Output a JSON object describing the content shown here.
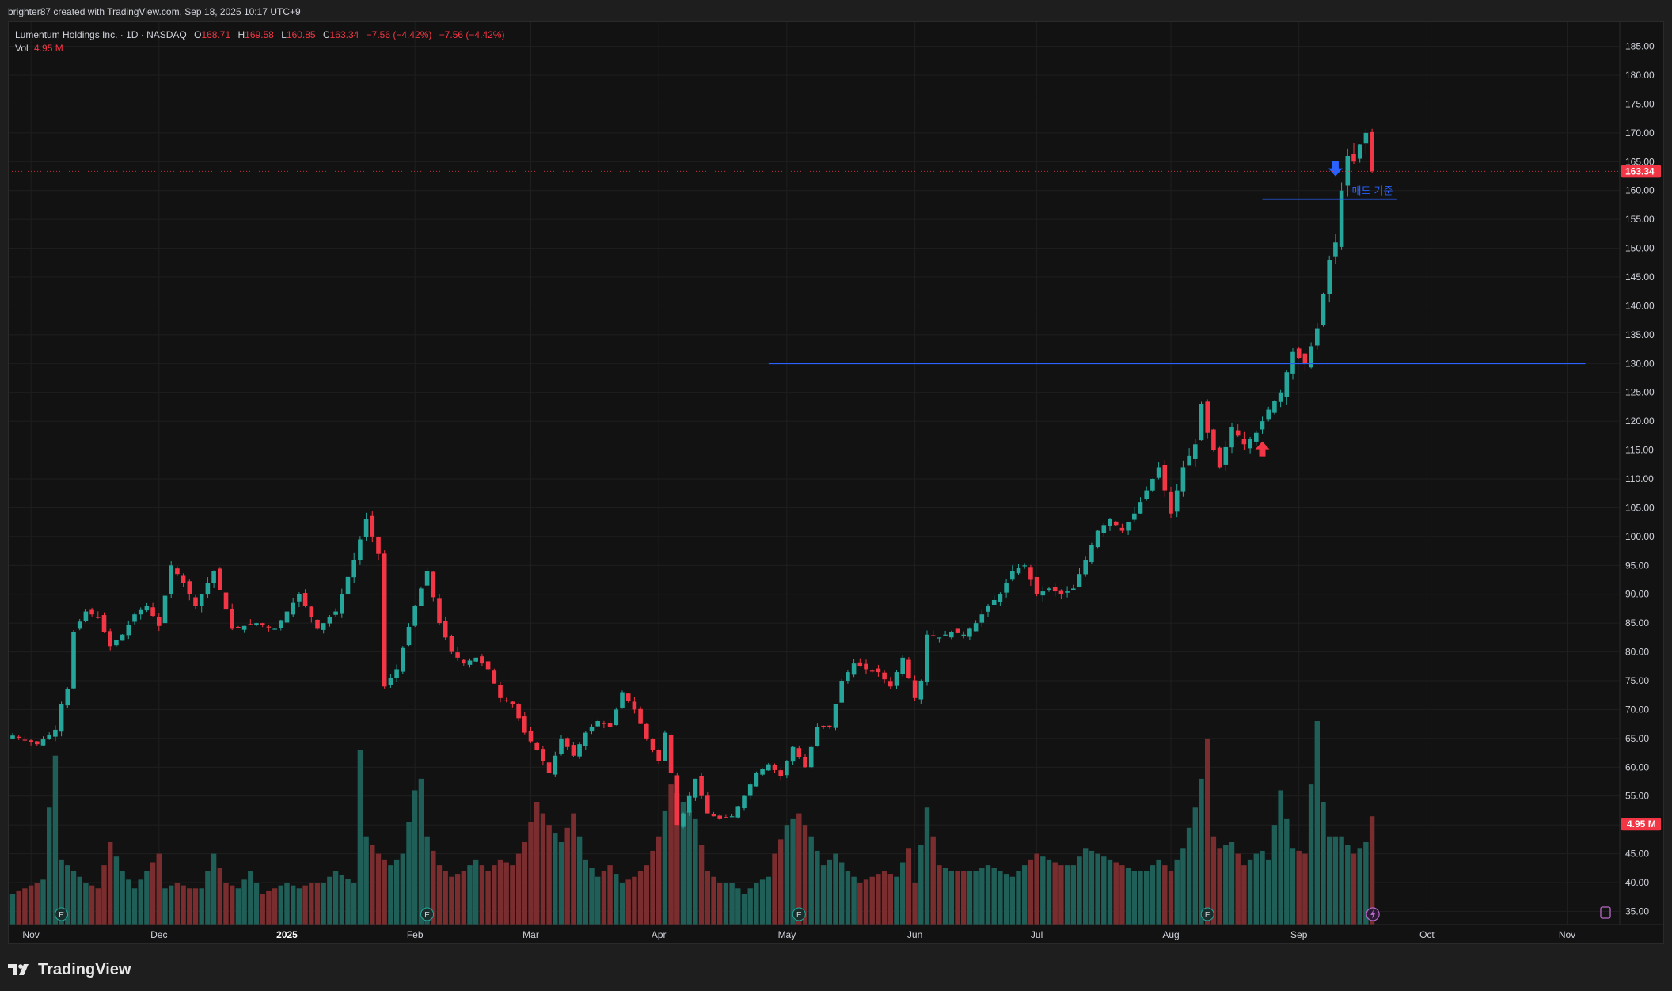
{
  "header": {
    "created_text": "brighter87 created with TradingView.com, Sep 18, 2025 10:17 UTC+9"
  },
  "legend": {
    "symbol": "Lumentum Holdings Inc. · 1D · NASDAQ",
    "o_label": "O",
    "o_value": "168.71",
    "h_label": "H",
    "h_value": "169.58",
    "l_label": "L",
    "l_value": "160.85",
    "c_label": "C",
    "c_value": "163.34",
    "change": "−7.56 (−4.42%)",
    "change2": "−7.56 (−4.42%)",
    "vol_label": "Vol",
    "vol_value": "4.95 M"
  },
  "footer": {
    "brand": "TradingView"
  },
  "colors": {
    "up": "#26a69a",
    "down": "#f23645",
    "vol_up": "#1f5f58",
    "vol_down": "#7a2d2e",
    "line": "#2962ff",
    "bg": "#121212"
  },
  "chart_data": {
    "type": "candlestick",
    "title": "Lumentum Holdings Inc. · 1D · NASDAQ",
    "ylim": [
      33,
      187
    ],
    "y_ticks": [
      "185.00",
      "180.00",
      "175.00",
      "170.00",
      "165.00",
      "160.00",
      "155.00",
      "150.00",
      "145.00",
      "140.00",
      "135.00",
      "130.00",
      "125.00",
      "120.00",
      "115.00",
      "110.00",
      "105.00",
      "100.00",
      "95.00",
      "90.00",
      "85.00",
      "80.00",
      "75.00",
      "70.00",
      "65.00",
      "60.00",
      "55.00",
      "50.00",
      "45.00",
      "40.00",
      "35.00"
    ],
    "x_ticks": [
      {
        "label": "Nov",
        "i": 3,
        "bold": false
      },
      {
        "label": "Dec",
        "i": 24,
        "bold": false
      },
      {
        "label": "2025",
        "i": 45,
        "bold": true
      },
      {
        "label": "Feb",
        "i": 66,
        "bold": false
      },
      {
        "label": "Mar",
        "i": 85,
        "bold": false
      },
      {
        "label": "Apr",
        "i": 106,
        "bold": false
      },
      {
        "label": "May",
        "i": 127,
        "bold": false
      },
      {
        "label": "Jun",
        "i": 148,
        "bold": false
      },
      {
        "label": "Jul",
        "i": 168,
        "bold": false
      },
      {
        "label": "Aug",
        "i": 190,
        "bold": false
      },
      {
        "label": "Sep",
        "i": 211,
        "bold": false
      },
      {
        "label": "Oct",
        "i": 232,
        "bold": false
      },
      {
        "label": "Nov",
        "i": 255,
        "bold": false
      }
    ],
    "last_price_label": "163.34",
    "last_price": 163.34,
    "last_volume_label": "4.95 M",
    "last_volume_level": 51.5,
    "earnings_marker_indices": [
      8,
      68,
      129,
      196
    ],
    "horizontal_lines": [
      {
        "value": 130,
        "from_index": 124,
        "to_index": 258
      },
      {
        "value": 158.5,
        "from_index": 205,
        "to_index": 227,
        "label": "매도 기준"
      }
    ],
    "arrows": [
      {
        "type": "buy",
        "index": 205,
        "value": 115
      },
      {
        "type": "sell",
        "index": 217,
        "value": 164
      }
    ],
    "waypoints": [
      [
        0,
        65.5
      ],
      [
        4,
        64.0
      ],
      [
        7,
        66.5
      ],
      [
        8,
        71.0
      ],
      [
        9,
        73.5
      ],
      [
        10,
        83.5
      ],
      [
        12,
        87.0
      ],
      [
        14,
        86.0
      ],
      [
        16,
        81.0
      ],
      [
        18,
        83.0
      ],
      [
        20,
        86.5
      ],
      [
        22,
        88.0
      ],
      [
        24,
        84.5
      ],
      [
        26,
        95.0
      ],
      [
        28,
        92.0
      ],
      [
        30,
        88.0
      ],
      [
        33,
        94.0
      ],
      [
        36,
        84.0
      ],
      [
        40,
        85.0
      ],
      [
        43,
        84.0
      ],
      [
        47,
        90.0
      ],
      [
        50,
        84.0
      ],
      [
        53,
        87.0
      ],
      [
        56,
        96.0
      ],
      [
        58,
        103.0
      ],
      [
        60,
        97.0
      ],
      [
        61,
        74.0
      ],
      [
        63,
        77.0
      ],
      [
        66,
        88.0
      ],
      [
        68,
        94.0
      ],
      [
        70,
        85.0
      ],
      [
        72,
        80.0
      ],
      [
        74,
        78.0
      ],
      [
        76,
        79.0
      ],
      [
        78,
        77.0
      ],
      [
        80,
        72.0
      ],
      [
        82,
        71.0
      ],
      [
        84,
        66.0
      ],
      [
        86,
        63.0
      ],
      [
        88,
        59.0
      ],
      [
        90,
        65.0
      ],
      [
        92,
        62.0
      ],
      [
        94,
        66.0
      ],
      [
        96,
        68.0
      ],
      [
        98,
        67.0
      ],
      [
        100,
        73.0
      ],
      [
        102,
        70.0
      ],
      [
        104,
        65.0
      ],
      [
        106,
        61.0
      ],
      [
        107,
        66.0
      ],
      [
        108,
        59.0
      ],
      [
        109,
        50.0
      ],
      [
        110,
        52.0
      ],
      [
        111,
        55.0
      ],
      [
        112,
        58.0
      ],
      [
        114,
        52.0
      ],
      [
        116,
        51.0
      ],
      [
        118,
        51.5
      ],
      [
        120,
        55.0
      ],
      [
        122,
        59.0
      ],
      [
        124,
        60.5
      ],
      [
        126,
        58.5
      ],
      [
        128,
        63.5
      ],
      [
        130,
        60.0
      ],
      [
        132,
        67.0
      ],
      [
        134,
        67.0
      ],
      [
        136,
        75.0
      ],
      [
        138,
        78.0
      ],
      [
        140,
        77.0
      ],
      [
        142,
        76.5
      ],
      [
        144,
        74.0
      ],
      [
        146,
        79.0
      ],
      [
        148,
        72.0
      ],
      [
        149,
        75.0
      ],
      [
        150,
        83.0
      ],
      [
        152,
        82.5
      ],
      [
        154,
        83.5
      ],
      [
        156,
        83.0
      ],
      [
        158,
        85.0
      ],
      [
        160,
        88.0
      ],
      [
        162,
        90.0
      ],
      [
        164,
        94.0
      ],
      [
        166,
        95.0
      ],
      [
        168,
        90.0
      ],
      [
        170,
        91.0
      ],
      [
        172,
        90.0
      ],
      [
        174,
        91.0
      ],
      [
        176,
        96.0
      ],
      [
        178,
        101.0
      ],
      [
        180,
        103.0
      ],
      [
        182,
        101.0
      ],
      [
        184,
        104.0
      ],
      [
        186,
        108.0
      ],
      [
        188,
        112.0
      ],
      [
        189,
        108.0
      ],
      [
        190,
        104.0
      ],
      [
        192,
        112.0
      ],
      [
        194,
        116.0
      ],
      [
        195,
        123.0
      ],
      [
        196,
        118.0
      ],
      [
        198,
        112.0
      ],
      [
        200,
        119.0
      ],
      [
        202,
        116.0
      ],
      [
        204,
        118.0
      ],
      [
        206,
        122.0
      ],
      [
        208,
        125.0
      ],
      [
        210,
        132.0
      ],
      [
        212,
        130.0
      ],
      [
        214,
        136.0
      ],
      [
        216,
        148.0
      ],
      [
        217,
        151.0
      ],
      [
        218,
        160.0
      ],
      [
        219,
        166.0
      ],
      [
        220,
        165.0
      ],
      [
        221,
        168.0
      ],
      [
        222,
        170.0
      ],
      [
        223,
        163.34
      ]
    ],
    "volume_waypoints": [
      [
        0,
        38.0
      ],
      [
        2,
        39.0
      ],
      [
        5,
        40.5
      ],
      [
        6,
        53.0
      ],
      [
        7,
        62.0
      ],
      [
        8,
        44.0
      ],
      [
        10,
        42.0
      ],
      [
        12,
        40.0
      ],
      [
        14,
        39.0
      ],
      [
        16,
        47.0
      ],
      [
        18,
        42.0
      ],
      [
        20,
        39.0
      ],
      [
        22,
        42.0
      ],
      [
        24,
        45.0
      ],
      [
        25,
        39.0
      ],
      [
        27,
        40.0
      ],
      [
        29,
        39.0
      ],
      [
        31,
        39.0
      ],
      [
        33,
        45.0
      ],
      [
        35,
        40.0
      ],
      [
        37,
        39.0
      ],
      [
        39,
        42.0
      ],
      [
        41,
        38.0
      ],
      [
        43,
        39.0
      ],
      [
        45,
        40.0
      ],
      [
        47,
        39.0
      ],
      [
        49,
        40.0
      ],
      [
        51,
        40.0
      ],
      [
        53,
        42.0
      ],
      [
        56,
        40.0
      ],
      [
        57,
        63.0
      ],
      [
        58,
        48.0
      ],
      [
        60,
        45.0
      ],
      [
        62,
        43.0
      ],
      [
        64,
        45.0
      ],
      [
        66,
        56.0
      ],
      [
        67,
        58.0
      ],
      [
        68,
        48.0
      ],
      [
        70,
        43.0
      ],
      [
        72,
        41.0
      ],
      [
        74,
        42.0
      ],
      [
        76,
        44.0
      ],
      [
        78,
        42.0
      ],
      [
        80,
        44.0
      ],
      [
        82,
        43.0
      ],
      [
        84,
        47.0
      ],
      [
        86,
        54.0
      ],
      [
        88,
        50.0
      ],
      [
        90,
        47.0
      ],
      [
        92,
        52.0
      ],
      [
        94,
        44.0
      ],
      [
        96,
        41.0
      ],
      [
        98,
        43.0
      ],
      [
        100,
        40.0
      ],
      [
        102,
        41.0
      ],
      [
        104,
        43.0
      ],
      [
        106,
        48.0
      ],
      [
        108,
        57.0
      ],
      [
        110,
        54.0
      ],
      [
        112,
        51.0
      ],
      [
        114,
        42.0
      ],
      [
        116,
        40.0
      ],
      [
        118,
        40.0
      ],
      [
        120,
        38.0
      ],
      [
        122,
        40.0
      ],
      [
        124,
        41.0
      ],
      [
        125,
        45.0
      ],
      [
        127,
        50.0
      ],
      [
        129,
        52.0
      ],
      [
        131,
        48.0
      ],
      [
        133,
        43.0
      ],
      [
        135,
        45.0
      ],
      [
        137,
        42.0
      ],
      [
        139,
        40.0
      ],
      [
        141,
        41.0
      ],
      [
        143,
        42.0
      ],
      [
        145,
        41.0
      ],
      [
        147,
        46.0
      ],
      [
        148,
        40.0
      ],
      [
        150,
        53.0
      ],
      [
        152,
        43.0
      ],
      [
        154,
        42.0
      ],
      [
        156,
        42.0
      ],
      [
        158,
        42.0
      ],
      [
        160,
        43.0
      ],
      [
        162,
        42.0
      ],
      [
        164,
        41.0
      ],
      [
        166,
        43.0
      ],
      [
        168,
        45.0
      ],
      [
        170,
        44.0
      ],
      [
        172,
        43.0
      ],
      [
        174,
        43.0
      ],
      [
        176,
        46.0
      ],
      [
        178,
        45.0
      ],
      [
        180,
        44.0
      ],
      [
        182,
        43.0
      ],
      [
        184,
        42.0
      ],
      [
        186,
        42.0
      ],
      [
        188,
        44.0
      ],
      [
        190,
        42.0
      ],
      [
        192,
        46.0
      ],
      [
        194,
        53.0
      ],
      [
        195,
        58.0
      ],
      [
        196,
        65.0
      ],
      [
        197,
        48.0
      ],
      [
        198,
        46.0
      ],
      [
        200,
        47.0
      ],
      [
        202,
        43.0
      ],
      [
        204,
        45.0
      ],
      [
        205,
        45.5
      ],
      [
        206,
        44.0
      ],
      [
        208,
        56.0
      ],
      [
        210,
        46.0
      ],
      [
        212,
        45.0
      ],
      [
        213,
        57.0
      ],
      [
        214,
        68.0
      ],
      [
        215,
        54.0
      ],
      [
        216,
        48.0
      ],
      [
        218,
        48.0
      ],
      [
        220,
        45.0
      ],
      [
        222,
        47.0
      ],
      [
        223,
        51.5
      ]
    ],
    "volume_ylim": [
      33,
      72
    ]
  }
}
